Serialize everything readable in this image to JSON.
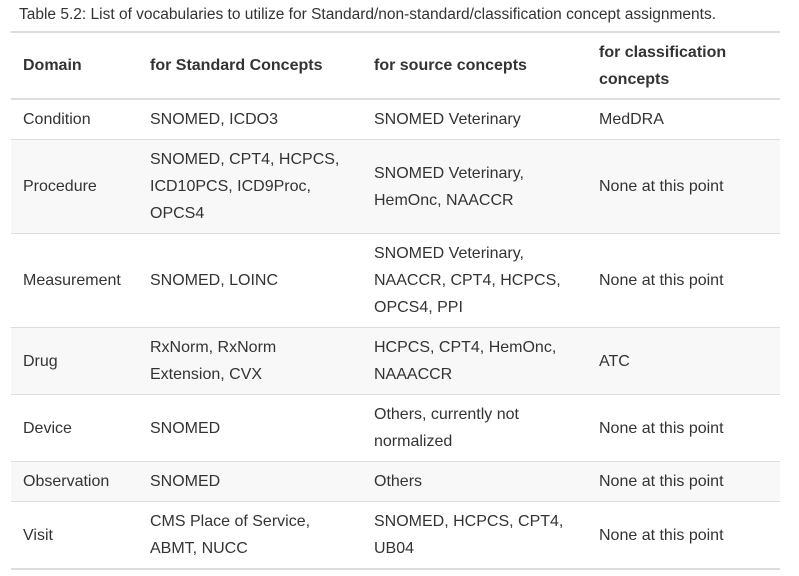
{
  "caption": "Table 5.2: List of vocabularies to utilize for Standard/non-standard/classification concept assignments.",
  "headers": [
    "Domain",
    "for Standard Concepts",
    "for source concepts",
    "for classification concepts"
  ],
  "rows": [
    [
      "Condition",
      "SNOMED, ICDO3",
      "SNOMED Veterinary",
      "MedDRA"
    ],
    [
      "Procedure",
      "SNOMED, CPT4, HCPCS, ICD10PCS, ICD9Proc, OPCS4",
      "SNOMED Veterinary, HemOnc, NAACCR",
      "None at this point"
    ],
    [
      "Measurement",
      "SNOMED, LOINC",
      "SNOMED Veterinary, NAACCR, CPT4, HCPCS, OPCS4, PPI",
      "None at this point"
    ],
    [
      "Drug",
      "RxNorm, RxNorm Extension, CVX",
      "HCPCS, CPT4, HemOnc, NAAACCR",
      "ATC"
    ],
    [
      "Device",
      "SNOMED",
      "Others, currently not normalized",
      "None at this point"
    ],
    [
      "Observation",
      "SNOMED",
      "Others",
      "None at this point"
    ],
    [
      "Visit",
      "CMS Place of Service, ABMT, NUCC",
      "SNOMED, HCPCS, CPT4, UB04",
      "None at this point"
    ]
  ]
}
